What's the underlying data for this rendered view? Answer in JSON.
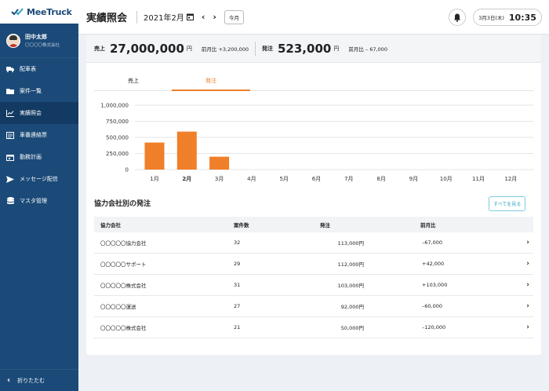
{
  "app": {
    "logo_text": "MeeTruck"
  },
  "user": {
    "name": "田中太郎",
    "company": "〇〇〇〇株式会社"
  },
  "sidebar": {
    "items": [
      {
        "label": "配車表",
        "icon": "truck-icon",
        "active": false
      },
      {
        "label": "案件一覧",
        "icon": "folder-icon",
        "active": false
      },
      {
        "label": "実績照会",
        "icon": "chart-icon",
        "active": true
      },
      {
        "label": "車番連絡票",
        "icon": "list-icon",
        "active": false
      },
      {
        "label": "勤務計画",
        "icon": "calendar-icon",
        "active": false
      },
      {
        "label": "メッセージ配信",
        "icon": "send-icon",
        "active": false
      },
      {
        "label": "マスタ管理",
        "icon": "database-icon",
        "active": false
      }
    ],
    "collapse_label": "折りたたむ"
  },
  "header": {
    "title": "実績照会",
    "month": "2021年2月",
    "today_label": "今月",
    "clock_date": "3月3日(木)",
    "clock_time": "10:35"
  },
  "summary": {
    "sales_label": "売上",
    "sales_value": "27,000,000",
    "sales_unit": "円",
    "sales_diff": "前月比 +3,200,000",
    "order_label": "発注",
    "order_value": "523,000",
    "order_unit": "円",
    "order_diff": "前月比 – 67,000"
  },
  "tabs": [
    {
      "label": "売上",
      "active": false
    },
    {
      "label": "発注",
      "active": true
    }
  ],
  "colors": {
    "accent": "#f07f2a",
    "sidebar": "#1b4a78",
    "link": "#2fa3c5"
  },
  "chart_data": {
    "type": "bar",
    "categories": [
      "1月",
      "2月",
      "3月",
      "4月",
      "5月",
      "6月",
      "7月",
      "8月",
      "9月",
      "10月",
      "11月",
      "12月"
    ],
    "values": [
      420000,
      590000,
      200000,
      0,
      0,
      0,
      0,
      0,
      0,
      0,
      0,
      0
    ],
    "highlight_category": "2月",
    "yticks": [
      "1,000,000",
      "750,000",
      "500,000",
      "250,000",
      "0"
    ],
    "ylim": [
      0,
      1000000
    ],
    "bar_color": "#f07f2a"
  },
  "partners": {
    "title": "協力会社別の発注",
    "see_all_label": "すべてを見る",
    "columns": [
      "協力会社",
      "案件数",
      "発注",
      "前月比"
    ],
    "rows": [
      {
        "name": "〇〇〇〇〇協力会社",
        "count": "32",
        "amount": "113,000円",
        "diff": "–67,000"
      },
      {
        "name": "〇〇〇〇〇サポート",
        "count": "29",
        "amount": "112,000円",
        "diff": "+42,000"
      },
      {
        "name": "〇〇〇〇〇株式会社",
        "count": "31",
        "amount": "103,000円",
        "diff": "+103,000"
      },
      {
        "name": "〇〇〇〇〇運送",
        "count": "27",
        "amount": "92,000円",
        "diff": "–60,000"
      },
      {
        "name": "〇〇〇〇〇株式会社",
        "count": "21",
        "amount": "50,000円",
        "diff": "–120,000"
      }
    ]
  }
}
